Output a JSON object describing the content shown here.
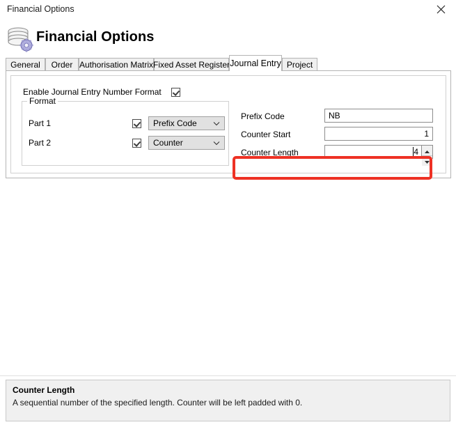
{
  "window": {
    "title": "Financial Options",
    "close_icon": "close-icon"
  },
  "header": {
    "icon": "database-gear-icon",
    "title": "Financial Options"
  },
  "tabs": [
    {
      "label": "General",
      "selected": false
    },
    {
      "label": "Order",
      "selected": false
    },
    {
      "label": "Authorisation Matrix",
      "selected": false
    },
    {
      "label": "Fixed Asset Register",
      "selected": false
    },
    {
      "label": "Journal Entry",
      "selected": true
    },
    {
      "label": "Project",
      "selected": false
    }
  ],
  "form": {
    "enable": {
      "label": "Enable Journal Entry Number Format",
      "checked": true
    },
    "format_group": {
      "title": "Format",
      "rows": [
        {
          "label": "Part 1",
          "checked": true,
          "value": "Prefix Code",
          "chevron": "chevron-down-icon"
        },
        {
          "label": "Part 2",
          "checked": true,
          "value": "Counter",
          "chevron": "chevron-down-icon"
        }
      ]
    },
    "fields": [
      {
        "label": "Prefix Code",
        "value": "NB",
        "align": "left"
      },
      {
        "label": "Counter Start",
        "value": "1",
        "align": "right"
      },
      {
        "label": "Counter Length",
        "value": "4",
        "align": "right"
      }
    ],
    "spinner": {
      "up_icon": "spinner-up-arrow-icon",
      "down_icon": "spinner-down-arrow-icon"
    }
  },
  "highlight": {
    "color": "#ee3124",
    "target": "counter-length-row"
  },
  "help": {
    "title": "Counter Length",
    "text": "A sequential number of the specified length. Counter will be left padded with 0."
  }
}
